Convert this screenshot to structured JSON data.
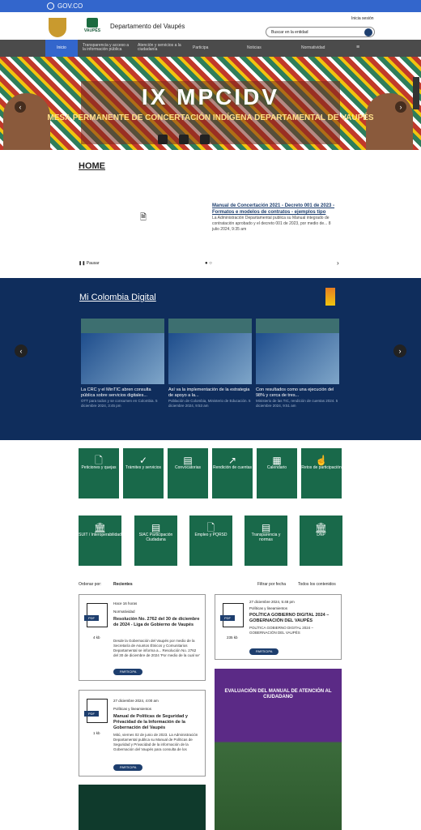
{
  "gov": {
    "label": "GOV.CO"
  },
  "header": {
    "dept": "Departamento del Vaupés",
    "brand": "VAUPÉS",
    "login": "Inicia sesión",
    "search_placeholder": "Buscar en la entidad"
  },
  "nav": {
    "items": [
      "Inicio",
      "Transparencia y acceso a la información pública",
      "Atención y servicios a la ciudadanía",
      "Participa",
      "Noticias",
      "Normatividad"
    ]
  },
  "banner": {
    "title": "IX MPCIDV",
    "subtitle": "MESA PERMANENTE DE CONCERTACIÓN INDÍGENA DEPARTAMENTAL DE VAUPÉS"
  },
  "home": {
    "title": "HOME",
    "news_title": "Manual de Concertación 2021 - Decreto 001 de 2023 - Formatos e modelos de contratos - ejemplos tipo",
    "news_desc": "La Administración Departamental publica su Manual integrado de contratación aprobado y el decreto 001 de 2023, por medio de... 8 julio 2024, 9:35 am",
    "pause": "Pausar"
  },
  "mcd": {
    "title": "Mi Colombia Digital",
    "cards": [
      {
        "title": "La CRC y el MinTIC abren consulta pública sobre servicios digitales...",
        "desc": "OTT para todos y se consumen en Colombia. 5 diciembre 2024, 3:45 pm"
      },
      {
        "title": "Así va la implementación de la estrategia de apoyo a la...",
        "desc": "Población de Colombia, Ministerio de Educación. 5 diciembre 2024, 9:53 am"
      },
      {
        "title": "Con resultados como una ejecución del 98% y cerca de tres...",
        "desc": "Ministerio de las TIC, rendición de cuentas 2024. 5 diciembre 2024, 9:51 am"
      }
    ]
  },
  "tiles_row1": [
    "Peticiones y quejas",
    "Trámites y servicios",
    "Convocatorias",
    "Rendición de cuentas",
    "Calendario",
    "Retos de participación"
  ],
  "tiles_row2": [
    "SUIT / Interoperabilidad",
    "SIAC Participación Ciudadana",
    "Empleo y PQRSD",
    "Transparencia y normas",
    "DNP"
  ],
  "sort": {
    "label": "Ordenar por:",
    "value": "Recientes",
    "filter1": "Filtrar por fecha",
    "filter2": "Todos los contenidos"
  },
  "posts": [
    {
      "size": "4 kb",
      "date": "Hace 16 horas",
      "cat": "Normatividad",
      "title": "Resolución No. 2762 del 30 de diciembre de 2024 - Liga de Gobierno de Vaupés",
      "desc": "Desde la Gobernación del Vaupés por medio de la Secretaría de Asuntos Étnicos y Comunitarios Departamental se informa a... Resolución No. 2762 del 30 de diciembre de 2024 'Por medio de la cual se'",
      "btn": "PARTICIPA"
    },
    {
      "size": "235 kb",
      "date": "27 diciembre 2024, 5:48 pm",
      "cat": "Políticas y lineamientos",
      "title": "POLÍTICA GOBIERNO DIGITAL 2024 – GOBERNACIÓN DEL VAUPÉS",
      "desc": "POLÍTICA GOBIERNO DIGITAL 2024 – GOBERNACIÓN DEL VAUPÉS",
      "btn": "PARTICIPA"
    },
    {
      "size": "1 kb",
      "date": "27 diciembre 2024, 4:00 am",
      "cat": "Políticas y lineamientos",
      "title": "Manual de Políticas de Seguridad y Privacidad de la Información de la Gobernación del Vaupés",
      "desc": "Mitú, viernes 02 de junio de 2023. La Administración Departamental publica su Manual de Políticas de Seguridad y Privacidad de la información de la Gobernación del Vaupés para consulta de los",
      "btn": "PARTICIPA"
    }
  ],
  "promo": {
    "title": "EVALUACIÓN DEL MANUAL DE ATENCIÓN AL CIUDADANO"
  }
}
